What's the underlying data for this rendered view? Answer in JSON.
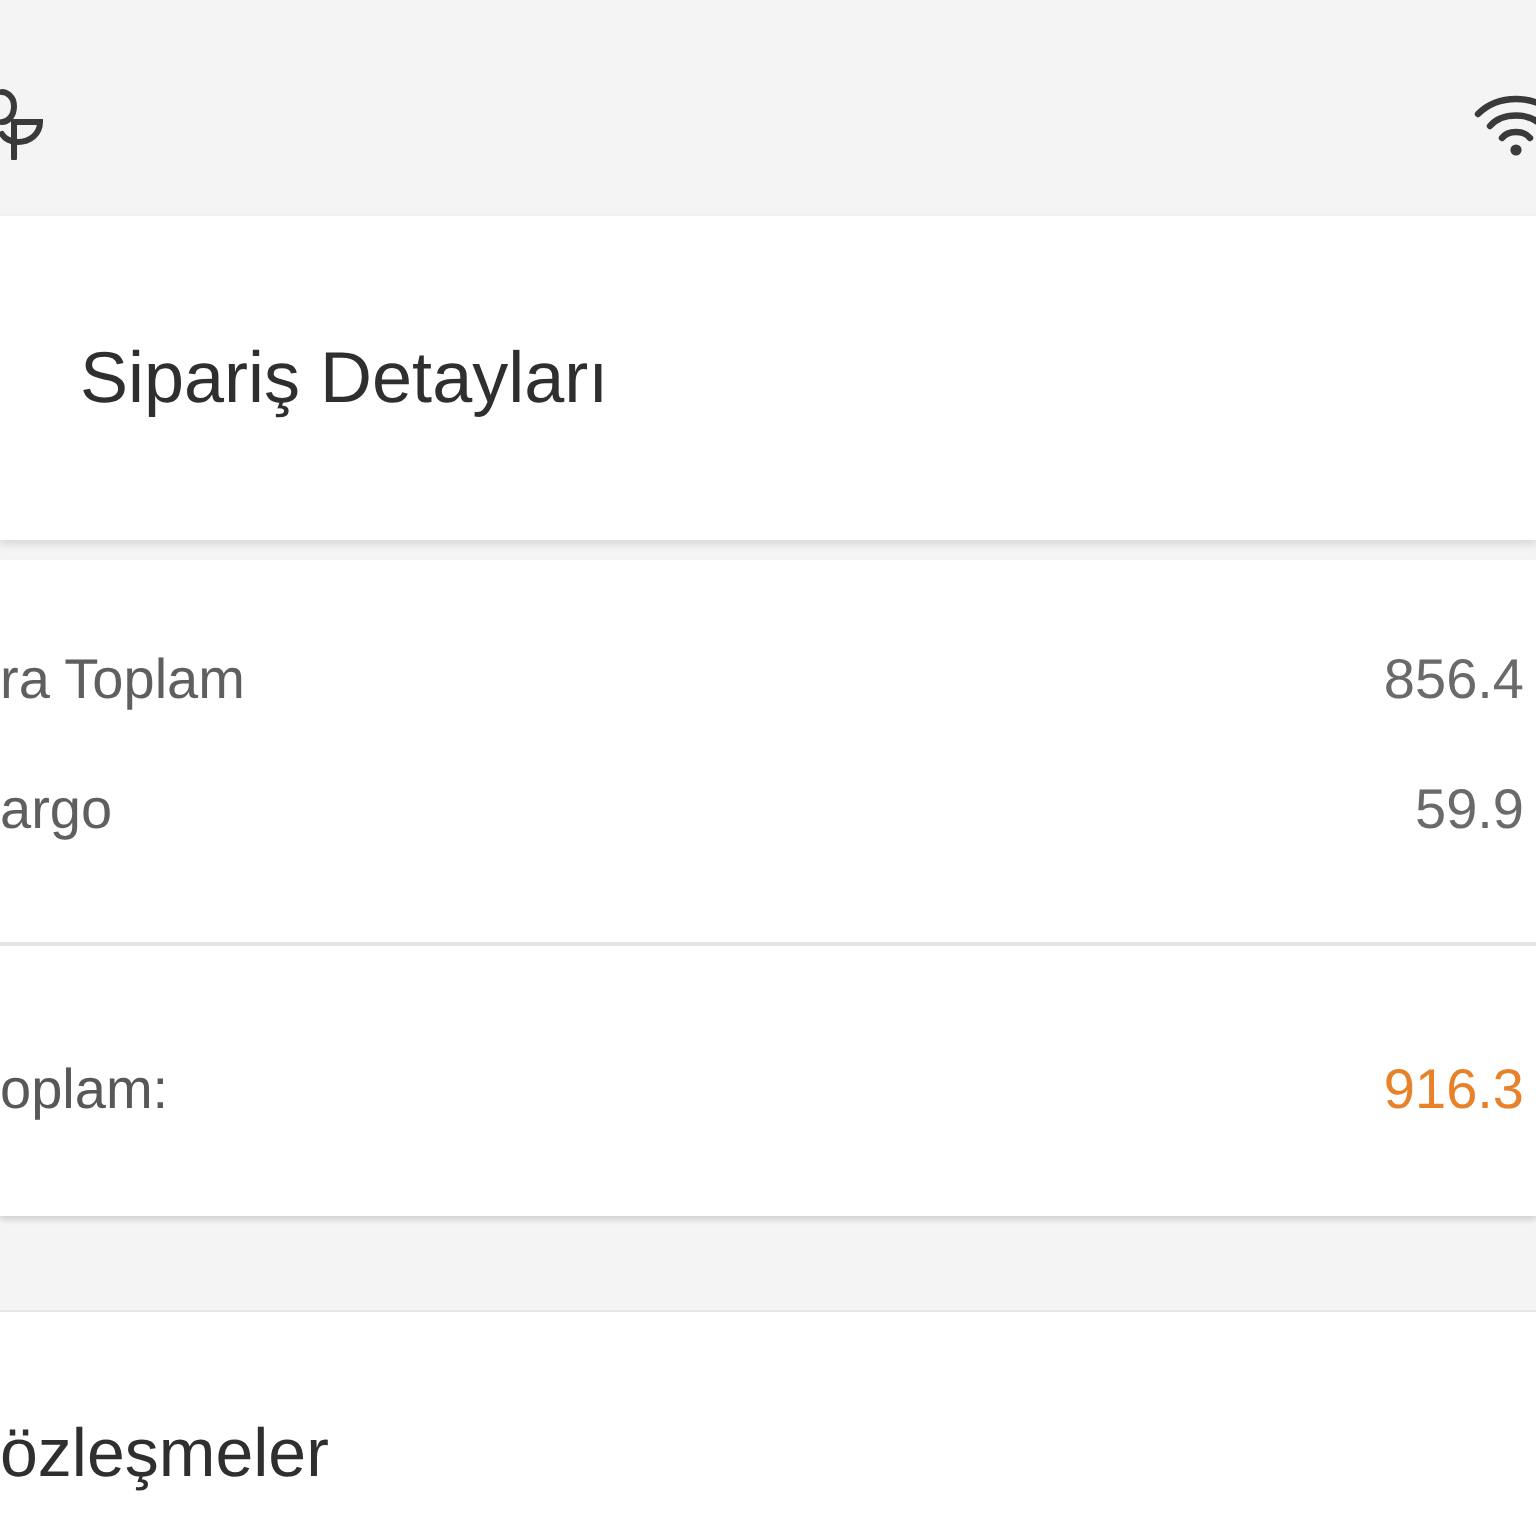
{
  "header": {
    "title": "Sipariş Detayları"
  },
  "summary": {
    "rows": [
      {
        "label": "ra Toplam",
        "value": "856.4"
      },
      {
        "label": "argo",
        "value": "59.9"
      }
    ],
    "total": {
      "label": "oplam:",
      "value": "916.3"
    }
  },
  "next_section": {
    "title": "özleşmeler"
  }
}
